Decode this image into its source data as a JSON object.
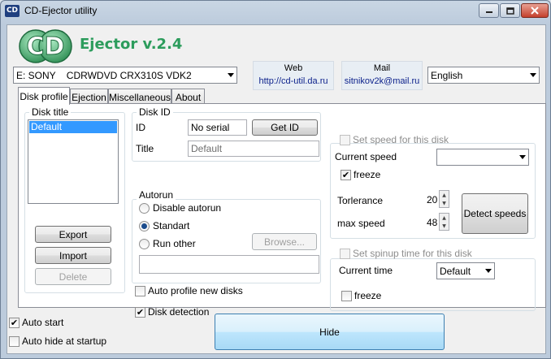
{
  "window": {
    "title": "CD-Ejector utility",
    "icon_text": "CD"
  },
  "header": {
    "logo_letters": "CD",
    "app_name": "Ejector v.2.4",
    "drive_select": "E: SONY    CDRWDVD CRX310S VDK2",
    "web_label": "Web",
    "web_value": "http://cd-util.da.ru",
    "mail_label": "Mail",
    "mail_value": "sitnikov2k@mail.ru",
    "language_select": "English"
  },
  "tabs": [
    {
      "label": "Disk profile",
      "active": true
    },
    {
      "label": "Ejection",
      "active": false
    },
    {
      "label": "Miscellaneous",
      "active": false
    },
    {
      "label": "About",
      "active": false
    }
  ],
  "disk_title": {
    "label": "Disk title",
    "items": [
      "Default"
    ],
    "selected": "Default",
    "export_label": "Export",
    "import_label": "Import",
    "delete_label": "Delete"
  },
  "disk_id": {
    "label": "Disk ID",
    "id_label": "ID",
    "id_value": "No serial",
    "get_id_label": "Get ID",
    "title_label": "Title",
    "title_value": "Default"
  },
  "autorun": {
    "label": "Autorun",
    "options": [
      "Disable autorun",
      "Standart",
      "Run other"
    ],
    "selected": "Standart",
    "browse_label": "Browse...",
    "path_value": ""
  },
  "options": {
    "auto_profile_label": "Auto profile new disks",
    "auto_profile_checked": false,
    "disk_detection_label": "Disk detection",
    "disk_detection_checked": true
  },
  "speed": {
    "set_speed_label": "Set speed for this disk",
    "set_speed_checked": false,
    "current_speed_label": "Current speed",
    "current_speed_value": "",
    "freeze_label": "freeze",
    "freeze_checked": true,
    "tolerance_label": "Torlerance",
    "tolerance_value": "20",
    "max_speed_label": "max speed",
    "max_speed_value": "48",
    "detect_label": "Detect speeds"
  },
  "spinup": {
    "set_spinup_label": "Set spinup time for this disk",
    "set_spinup_checked": false,
    "current_time_label": "Current time",
    "current_time_value": "Default",
    "freeze_label": "freeze",
    "freeze_checked": false
  },
  "footer": {
    "auto_start_label": "Auto start",
    "auto_start_checked": true,
    "auto_hide_label": "Auto hide at startup",
    "auto_hide_checked": false,
    "hide_label": "Hide"
  },
  "colors": {
    "logo_green": "#2c9c5c",
    "selection_blue": "#3399ff",
    "link_blue": "#0a1f8a"
  }
}
